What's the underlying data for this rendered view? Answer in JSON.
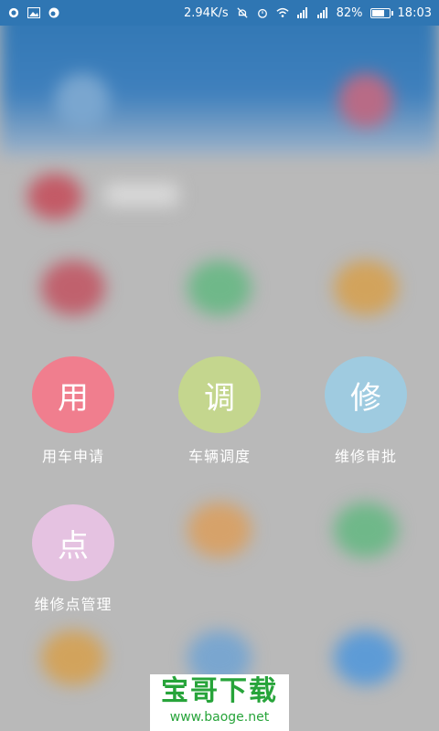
{
  "status_bar": {
    "network_speed": "2.94K/s",
    "battery_percent": "82%",
    "battery_level": 0.82,
    "time": "18:03",
    "icons": [
      "share-icon",
      "image-icon",
      "cloud-icon",
      "mute-icon",
      "alarm-icon",
      "wifi-icon",
      "signal-icon",
      "signal-icon",
      "battery-icon"
    ]
  },
  "menu": {
    "items": [
      {
        "glyph": "用",
        "label": "用车申请",
        "color": "#f07e8e"
      },
      {
        "glyph": "调",
        "label": "车辆调度",
        "color": "#c4d68e"
      },
      {
        "glyph": "修",
        "label": "维修审批",
        "color": "#9fcbe0"
      },
      {
        "glyph": "点",
        "label": "维修点管理",
        "color": "#e5c2e1"
      }
    ]
  },
  "watermark": {
    "title": "宝哥下载",
    "url": "www.baoge.net"
  }
}
